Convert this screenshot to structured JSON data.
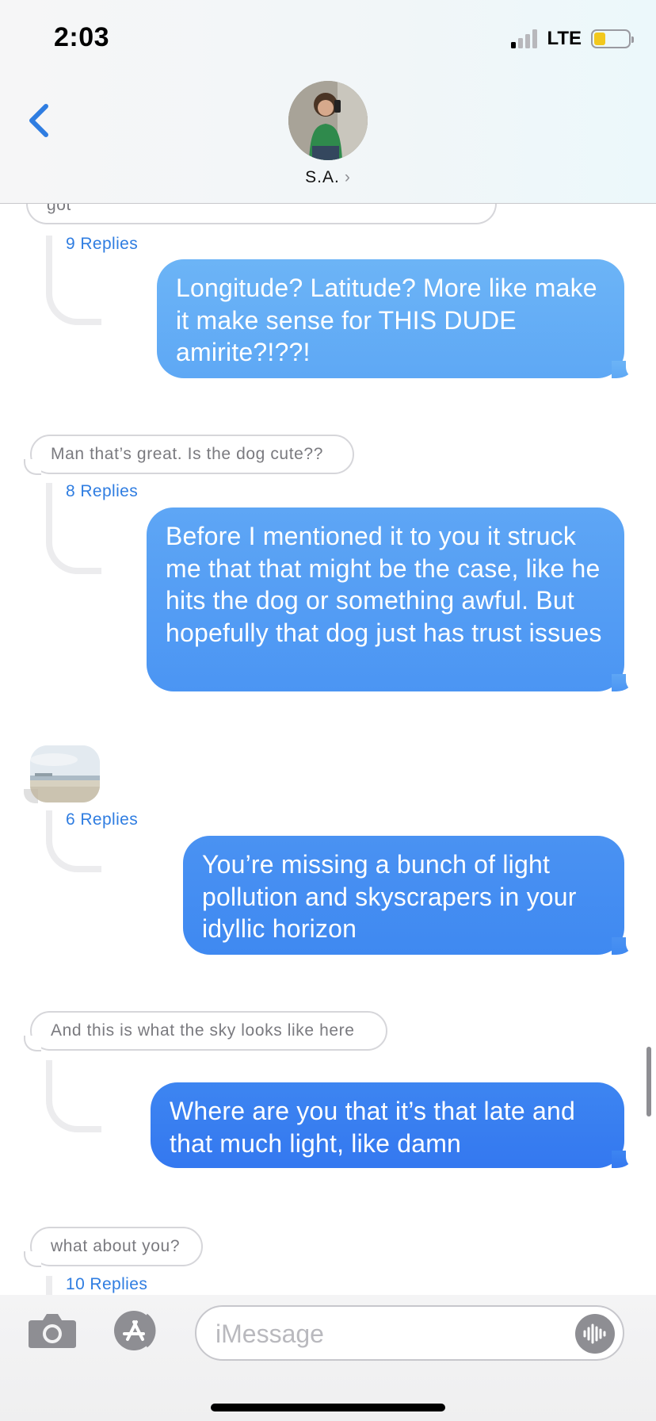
{
  "status_bar": {
    "time": "2:03",
    "network": "LTE",
    "battery_color": "#f2c81d"
  },
  "header": {
    "contact_name": "S.A.",
    "chevron": "›",
    "back_icon": "chevron-left-icon"
  },
  "thread": {
    "top_partial_text": "got",
    "messages": [
      {
        "replies": "9 Replies",
        "reply_text": "Longitude? Latitude? More like make it make sense for THIS DUDE amirite?!??!"
      },
      {
        "incoming": "Man that’s great. Is the dog cute??",
        "replies": "8 Replies",
        "reply_text": "Before I mentioned it to you it struck me that that might be the case, like he hits the dog or something awful. But hopefully that dog just has trust issues"
      },
      {
        "incoming_image": "beach-horizon-photo",
        "replies": "6 Replies",
        "reply_text": "You’re missing a bunch of light pollution and skyscrapers in your idyllic horizon"
      },
      {
        "incoming": "And this is what the sky looks like here",
        "reply_text": "Where are you that it’s that late and that much light, like damn"
      },
      {
        "incoming": "what about you?",
        "replies": "10 Replies"
      }
    ]
  },
  "input_bar": {
    "placeholder": "iMessage",
    "camera_icon": "camera-icon",
    "apps_icon": "app-store-icon",
    "audio_icon": "audio-waveform-icon"
  },
  "colors": {
    "accent": "#2f7de1",
    "bubble_top": "#6cb4f6",
    "bubble_bottom": "#3478f0"
  }
}
